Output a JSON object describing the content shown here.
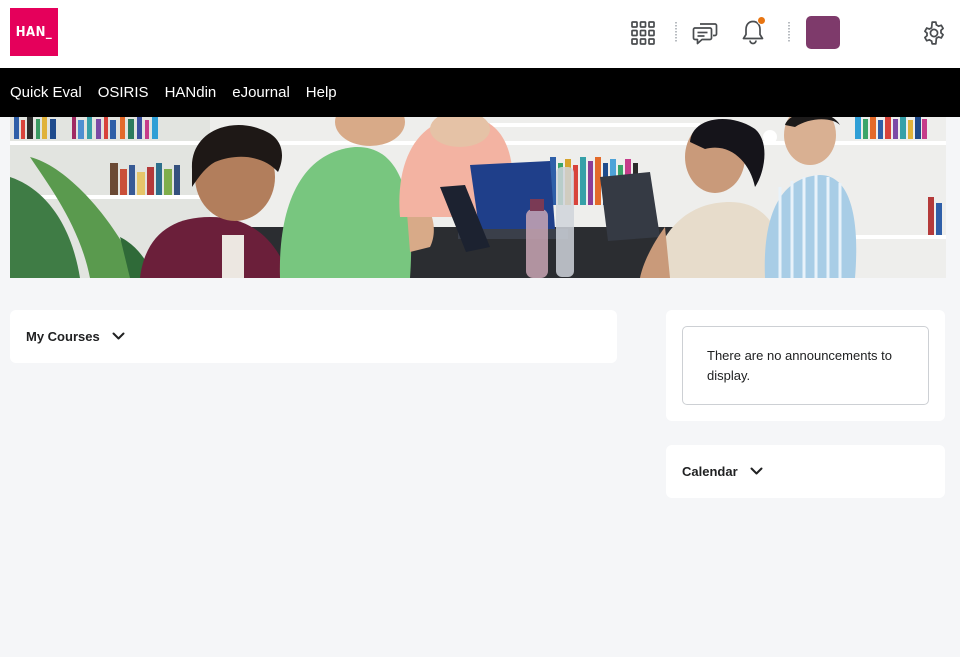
{
  "header": {
    "logo_text": "HAN_",
    "icons": [
      "apps-grid-icon",
      "message-alerts-icon",
      "notification-bell-icon",
      "settings-gear-icon"
    ],
    "avatar_color": "#7e3a6b",
    "brand_color": "#e5005b",
    "notification_dot_color": "#e87511"
  },
  "nav": {
    "items": [
      {
        "label": "Quick Eval"
      },
      {
        "label": "OSIRIS"
      },
      {
        "label": "HANdin"
      },
      {
        "label": "eJournal"
      },
      {
        "label": "Help"
      }
    ]
  },
  "banner": {
    "image": "students-at-table-photo"
  },
  "widgets": {
    "my_courses": {
      "title": "My Courses"
    },
    "announcements": {
      "message": "There are no announcements to display."
    },
    "calendar": {
      "title": "Calendar"
    }
  }
}
